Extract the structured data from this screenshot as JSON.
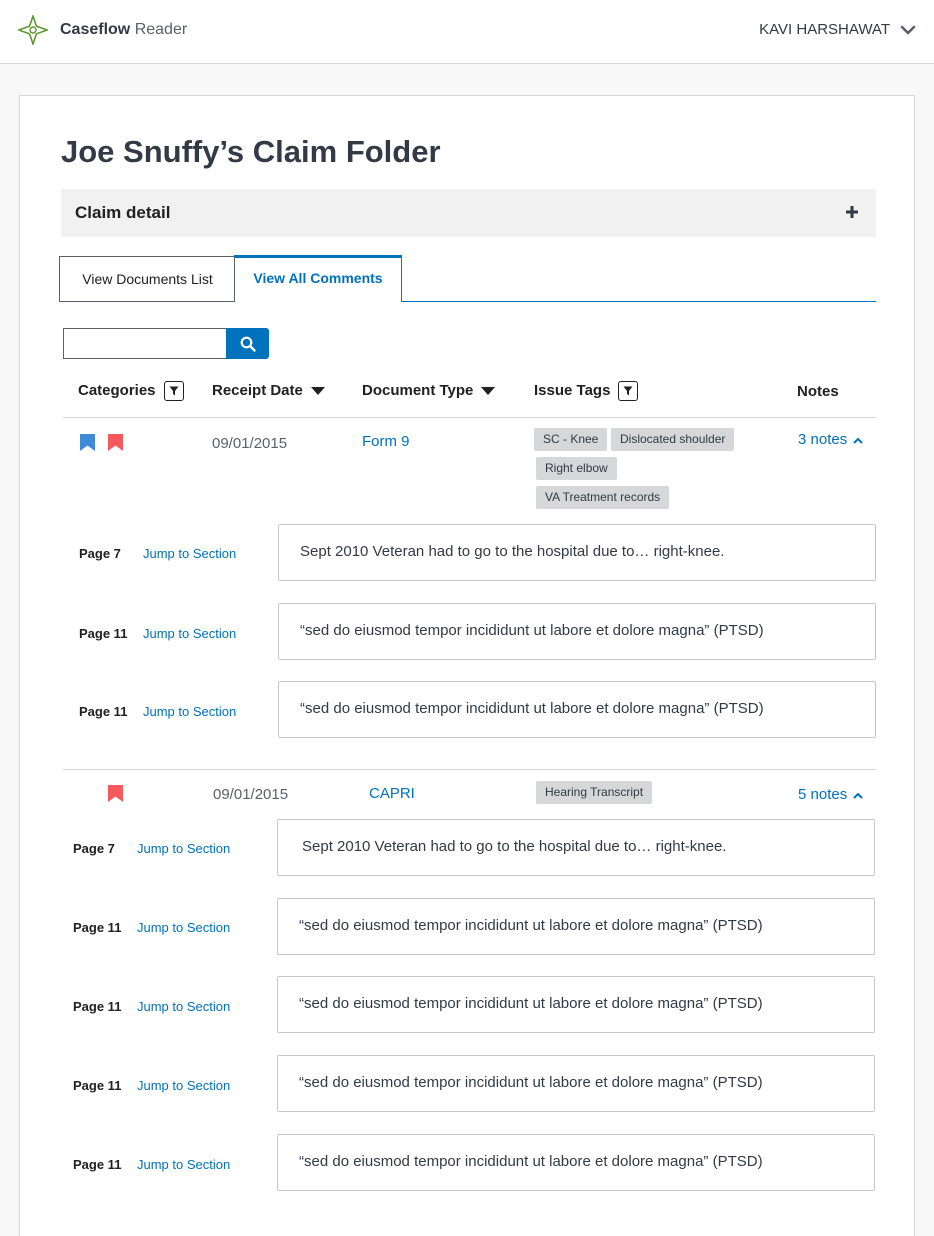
{
  "app": {
    "brand": "Caseflow",
    "product": "Reader",
    "user": "KAVI HARSHAWAT"
  },
  "page": {
    "title": "Joe Snuffy’s Claim Folder"
  },
  "claim_detail": {
    "label": "Claim detail"
  },
  "tabs": [
    {
      "label": "View Documents List",
      "active": false
    },
    {
      "label": "View All Comments",
      "active": true
    }
  ],
  "search": {
    "placeholder": "",
    "value": ""
  },
  "columns": {
    "categories": "Categories",
    "receipt_date": "Receipt Date",
    "document_type": "Document Type",
    "issue_tags": "Issue Tags",
    "notes": "Notes"
  },
  "documents": [
    {
      "categories": [
        "blue",
        "red"
      ],
      "receipt_date": "09/01/2015",
      "type": "Form 9",
      "tags": [
        "SC - Knee",
        "Dislocated shoulder",
        "Right elbow",
        "VA Treatment records"
      ],
      "notes_label": "3 notes",
      "comments": [
        {
          "page": "Page 7",
          "jump": "Jump to Section",
          "text": "Sept 2010 Veteran had to go to the hospital due to… right-knee."
        },
        {
          "page": "Page 11",
          "jump": "Jump to Section",
          "text": "“sed do eiusmod tempor incididunt ut labore et dolore magna” (PTSD)"
        },
        {
          "page": "Page 11",
          "jump": "Jump to Section",
          "text": "“sed do eiusmod tempor incididunt ut labore et dolore magna” (PTSD)"
        }
      ]
    },
    {
      "categories": [
        "red"
      ],
      "receipt_date": "09/01/2015",
      "type": "CAPRI",
      "tags": [
        "Hearing Transcript"
      ],
      "notes_label": "5 notes",
      "comments": [
        {
          "page": "Page 7",
          "jump": "Jump to Section",
          "text": "Sept 2010 Veteran had to go to the hospital due to… right-knee."
        },
        {
          "page": "Page 11",
          "jump": "Jump to Section",
          "text": "“sed do eiusmod tempor incididunt ut labore et dolore magna” (PTSD)"
        },
        {
          "page": "Page 11",
          "jump": "Jump to Section",
          "text": "“sed do eiusmod tempor incididunt ut labore et dolore magna” (PTSD)"
        },
        {
          "page": "Page 11",
          "jump": "Jump to Section",
          "text": "“sed do eiusmod tempor incididunt ut labore et dolore magna” (PTSD)"
        },
        {
          "page": "Page 11",
          "jump": "Jump to Section",
          "text": "“sed do eiusmod tempor incididunt ut labore et dolore magna” (PTSD)"
        }
      ]
    }
  ],
  "colors": {
    "accent": "#0071bc",
    "bookmark_blue": "#3e8bd8",
    "bookmark_red": "#f5595b",
    "tag_bg": "#d6d7d9",
    "logo_green": "#5e9732"
  },
  "icons": {
    "logo": "caseflow-star-icon",
    "user_menu": "chevron-down-icon",
    "claim_detail": "plus-icon",
    "search": "search-icon",
    "filter": "filter-icon",
    "sort": "sort-down-icon",
    "bookmark": "bookmark-icon",
    "notes": "chevron-up-icon"
  }
}
